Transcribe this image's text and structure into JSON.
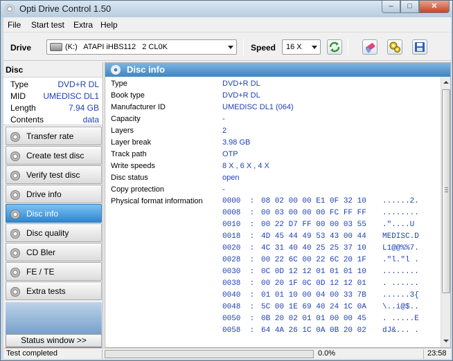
{
  "window": {
    "title": "Opti Drive Control 1.50",
    "min": "–",
    "max": "□",
    "close": "✕"
  },
  "menu": [
    "File",
    "Start test",
    "Extra",
    "Help"
  ],
  "toolbar": {
    "drive_label": "Drive",
    "drive_value": "(K:)   ATAPI iHBS112   2 CL0K",
    "speed_label": "Speed",
    "speed_value": "16 X",
    "buttons": [
      "refresh-icon",
      "eraser-icon",
      "settings-icon",
      "save-icon"
    ]
  },
  "sidebar": {
    "heading": "Disc",
    "summary": [
      {
        "key": "Type",
        "value": "DVD+R DL"
      },
      {
        "key": "MID",
        "value": "UMEDISC DL1"
      },
      {
        "key": "Length",
        "value": "7.94 GB"
      },
      {
        "key": "Contents",
        "value": "data"
      }
    ],
    "nav": [
      {
        "label": "Transfer rate",
        "active": false
      },
      {
        "label": "Create test disc",
        "active": false
      },
      {
        "label": "Verify test disc",
        "active": false
      },
      {
        "label": "Drive info",
        "active": false
      },
      {
        "label": "Disc info",
        "active": true
      },
      {
        "label": "Disc quality",
        "active": false
      },
      {
        "label": "CD Bler",
        "active": false
      },
      {
        "label": "FE / TE",
        "active": false
      },
      {
        "label": "Extra tests",
        "active": false
      }
    ],
    "status_window_button": "Status window >>"
  },
  "main": {
    "title": "Disc info",
    "info": [
      {
        "key": "Type",
        "value": "DVD+R DL"
      },
      {
        "key": "Book type",
        "value": "DVD+R DL"
      },
      {
        "key": "Manufacturer ID",
        "value": "UMEDISC DL1 (064)"
      },
      {
        "key": "Capacity",
        "value": "-"
      },
      {
        "key": "Layers",
        "value": "2"
      },
      {
        "key": "Layer break",
        "value": "3.98 GB"
      },
      {
        "key": "Track path",
        "value": "OTP"
      },
      {
        "key": "Write speeds",
        "value": "8 X , 6 X , 4 X"
      },
      {
        "key": "Disc status",
        "value": "open"
      },
      {
        "key": "Copy protection",
        "value": "-"
      },
      {
        "key": "Physical format information",
        "value": ""
      }
    ],
    "hex": [
      {
        "offset": "0000  :",
        "bytes": "08 02 00 00 E1 0F 32 10",
        "ascii": "......2."
      },
      {
        "offset": "0008  :",
        "bytes": "00 03 00 00 00 FC FF FF",
        "ascii": "........"
      },
      {
        "offset": "0010  :",
        "bytes": "00 22 D7 FF 00 00 03 55",
        "ascii": ".\"....U"
      },
      {
        "offset": "0018  :",
        "bytes": "4D 45 44 49 53 43 00 44",
        "ascii": "MEDISC.D"
      },
      {
        "offset": "0020  :",
        "bytes": "4C 31 40 40 25 25 37 10",
        "ascii": "L1@@%%7."
      },
      {
        "offset": "0028  :",
        "bytes": "00 22 6C 00 22 6C 20 1F",
        "ascii": ".\"l.\"l ."
      },
      {
        "offset": "0030  :",
        "bytes": "0C 0D 12 12 01 01 01 10",
        "ascii": "........"
      },
      {
        "offset": "0038  :",
        "bytes": "00 20 1F 0C 0D 12 12 01",
        "ascii": ". ......"
      },
      {
        "offset": "0040  :",
        "bytes": "01 01 10 00 04 00 33 7B",
        "ascii": "......3{"
      },
      {
        "offset": "0048  :",
        "bytes": "5C 00 1E 69 40 24 1C 0A",
        "ascii": "\\..i@$.."
      },
      {
        "offset": "0050  :",
        "bytes": "0B 20 02 01 01 00 00 45",
        "ascii": ". .....E"
      },
      {
        "offset": "0058  :",
        "bytes": "64 4A 26 1C 0A 0B 20 02",
        "ascii": "dJ&... ."
      }
    ]
  },
  "status": {
    "text": "Test completed",
    "progress_pct": 0,
    "progress_label": "0.0%",
    "time": "23:58"
  }
}
